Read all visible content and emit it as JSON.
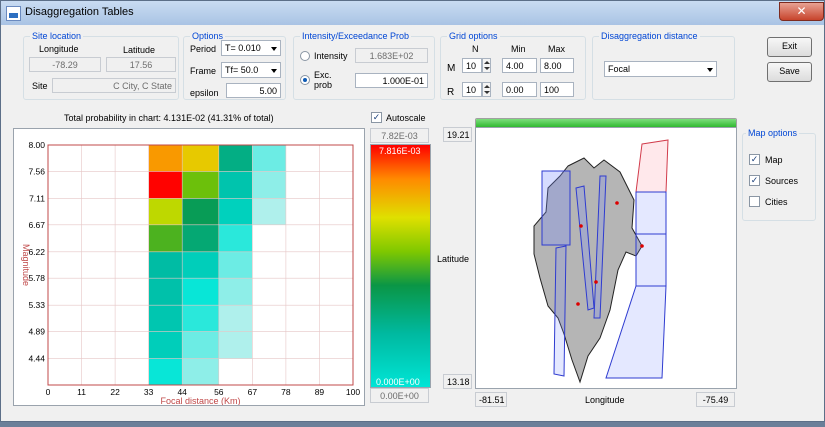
{
  "window": {
    "title": "Disaggregation Tables",
    "close_label": "✕"
  },
  "site_location": {
    "title": "Site location",
    "longitude_label": "Longitude",
    "latitude_label": "Latitude",
    "longitude_value": "-78.29",
    "latitude_value": "17.56",
    "site_label": "Site",
    "site_value": "C City, C State"
  },
  "options": {
    "title": "Options",
    "period_label": "Period",
    "period_value": "T= 0.010",
    "frame_label": "Frame",
    "frame_value": "Tf= 50.0",
    "epsilon_label": "epsilon",
    "epsilon_value": "5.00"
  },
  "intensity": {
    "title": "Intensity/Exceedance Prob",
    "intensity_label": "Intensity",
    "intensity_value": "1.683E+02",
    "exc_label_1": "Exc.",
    "exc_label_2": "prob",
    "exc_value": "1.000E-01",
    "selected": "exc"
  },
  "grid_options": {
    "title": "Grid options",
    "col_n": "N",
    "col_min": "Min",
    "col_max": "Max",
    "m_label": "M",
    "m_n": "10",
    "m_min": "4.00",
    "m_max": "8.00",
    "r_label": "R",
    "r_n": "10",
    "r_min": "0.00",
    "r_max": "100"
  },
  "disagg_distance": {
    "title": "Disaggregation distance",
    "value": "Focal"
  },
  "buttons": {
    "exit": "Exit",
    "save": "Save"
  },
  "total_probability": "Total probability in chart: 4.131E-02 (41.31% of total)",
  "autoscale": {
    "label": "Autoscale",
    "checked": true
  },
  "scale": {
    "top_field": "7.82E-03",
    "top_value": "7.816E-03",
    "bottom_value": "0.000E+00",
    "bottom_field": "0.00E+00"
  },
  "progress": {
    "percent": 100
  },
  "map": {
    "lat_max": "19.21",
    "lat_min": "13.18",
    "lon_min": "-81.51",
    "lon_max": "-75.49",
    "lat_label": "Latitude",
    "lon_label": "Longitude"
  },
  "map_options": {
    "title": "Map options",
    "items": [
      {
        "label": "Map",
        "checked": true
      },
      {
        "label": "Sources",
        "checked": true
      },
      {
        "label": "Cities",
        "checked": false
      }
    ]
  },
  "colors": {
    "accent": "#0046d5",
    "axis": "#c04848",
    "ramp_top": "#ff0000",
    "ramp_bottom": "#00e5d6"
  },
  "chart_data": {
    "type": "heatmap",
    "xlabel": "Focal distance (Km)",
    "ylabel": "Magnitude",
    "x_ticks": [
      "0",
      "11",
      "22",
      "33",
      "44",
      "56",
      "67",
      "78",
      "89",
      "100"
    ],
    "y_ticks": [
      "4.44",
      "4.89",
      "5.33",
      "5.78",
      "6.22",
      "6.67",
      "7.11",
      "7.56",
      "8.00"
    ],
    "xlim": [
      0,
      100
    ],
    "ylim": [
      4.0,
      8.0
    ],
    "grid": true,
    "color_scale": {
      "min": 0.0,
      "max": 0.007816
    },
    "x_bins": [
      0,
      11,
      22,
      33,
      44,
      56,
      67,
      78,
      89,
      100
    ],
    "y_bins": [
      4.0,
      4.44,
      4.89,
      5.33,
      5.78,
      6.22,
      6.67,
      7.11,
      7.56,
      8.0
    ],
    "cells": [
      {
        "x0": 33,
        "x1": 44,
        "y0": 7.56,
        "y1": 8.0,
        "value": 0.0065
      },
      {
        "x0": 44,
        "x1": 56,
        "y0": 7.56,
        "y1": 8.0,
        "value": 0.0058
      },
      {
        "x0": 56,
        "x1": 67,
        "y0": 7.56,
        "y1": 8.0,
        "value": 0.0022
      },
      {
        "x0": 67,
        "x1": 78,
        "y0": 7.56,
        "y1": 8.0,
        "value": 0.0003
      },
      {
        "x0": 33,
        "x1": 44,
        "y0": 7.11,
        "y1": 7.56,
        "value": 0.0078
      },
      {
        "x0": 44,
        "x1": 56,
        "y0": 7.11,
        "y1": 7.56,
        "value": 0.0042
      },
      {
        "x0": 56,
        "x1": 67,
        "y0": 7.11,
        "y1": 7.56,
        "value": 0.0013
      },
      {
        "x0": 67,
        "x1": 78,
        "y0": 7.11,
        "y1": 7.56,
        "value": 0.0002
      },
      {
        "x0": 33,
        "x1": 44,
        "y0": 6.67,
        "y1": 7.11,
        "value": 0.0051
      },
      {
        "x0": 44,
        "x1": 56,
        "y0": 6.67,
        "y1": 7.11,
        "value": 0.003
      },
      {
        "x0": 56,
        "x1": 67,
        "y0": 6.67,
        "y1": 7.11,
        "value": 0.0008
      },
      {
        "x0": 67,
        "x1": 78,
        "y0": 6.67,
        "y1": 7.11,
        "value": 0.0001
      },
      {
        "x0": 33,
        "x1": 44,
        "y0": 6.22,
        "y1": 6.67,
        "value": 0.0039
      },
      {
        "x0": 44,
        "x1": 56,
        "y0": 6.22,
        "y1": 6.67,
        "value": 0.0025
      },
      {
        "x0": 56,
        "x1": 67,
        "y0": 6.22,
        "y1": 6.67,
        "value": 0.0005
      },
      {
        "x0": 33,
        "x1": 44,
        "y0": 5.78,
        "y1": 6.22,
        "value": 0.0016
      },
      {
        "x0": 44,
        "x1": 56,
        "y0": 5.78,
        "y1": 6.22,
        "value": 0.0009
      },
      {
        "x0": 56,
        "x1": 67,
        "y0": 5.78,
        "y1": 6.22,
        "value": 0.0003
      },
      {
        "x0": 33,
        "x1": 44,
        "y0": 5.33,
        "y1": 5.78,
        "value": 0.0014
      },
      {
        "x0": 44,
        "x1": 56,
        "y0": 5.33,
        "y1": 5.78,
        "value": 0.0006
      },
      {
        "x0": 56,
        "x1": 67,
        "y0": 5.33,
        "y1": 5.78,
        "value": 0.0002
      },
      {
        "x0": 33,
        "x1": 44,
        "y0": 4.89,
        "y1": 5.33,
        "value": 0.0012
      },
      {
        "x0": 44,
        "x1": 56,
        "y0": 4.89,
        "y1": 5.33,
        "value": 0.0005
      },
      {
        "x0": 56,
        "x1": 67,
        "y0": 4.89,
        "y1": 5.33,
        "value": 0.0001
      },
      {
        "x0": 33,
        "x1": 44,
        "y0": 4.44,
        "y1": 4.89,
        "value": 0.0009
      },
      {
        "x0": 44,
        "x1": 56,
        "y0": 4.44,
        "y1": 4.89,
        "value": 0.0003
      },
      {
        "x0": 56,
        "x1": 67,
        "y0": 4.44,
        "y1": 4.89,
        "value": 0.0001
      },
      {
        "x0": 33,
        "x1": 44,
        "y0": 4.0,
        "y1": 4.44,
        "value": 0.0006
      },
      {
        "x0": 44,
        "x1": 56,
        "y0": 4.0,
        "y1": 4.44,
        "value": 0.0002
      }
    ]
  }
}
